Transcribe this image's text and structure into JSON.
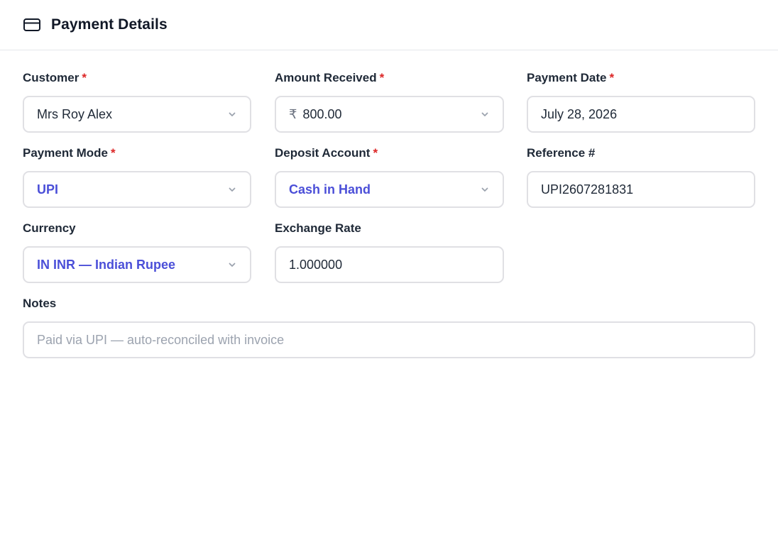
{
  "header": {
    "icon": "credit-card-icon",
    "title": "Payment Details"
  },
  "required_mark": "*",
  "fields": {
    "customer": {
      "label": "Customer",
      "value": "Mrs Roy Alex"
    },
    "amount_received": {
      "label": "Amount Received",
      "currency_symbol": "₹",
      "value": "800.00"
    },
    "payment_date": {
      "label": "Payment Date",
      "value": "July 28, 2026"
    },
    "payment_mode": {
      "label": "Payment Mode",
      "value": "UPI"
    },
    "deposit_account": {
      "label": "Deposit Account",
      "value": "Cash in Hand"
    },
    "reference": {
      "label": "Reference #",
      "value": "UPI2607281831"
    },
    "currency": {
      "label": "Currency",
      "value": "IN INR — Indian Rupee"
    },
    "exchange_rate": {
      "label": "Exchange Rate",
      "value": "1.000000"
    },
    "notes": {
      "label": "Notes",
      "placeholder": "Paid via UPI — auto-reconciled with invoice"
    }
  },
  "colors": {
    "accent": "#4b4fd8",
    "required": "#dc2626",
    "border": "#e0e0e4"
  }
}
